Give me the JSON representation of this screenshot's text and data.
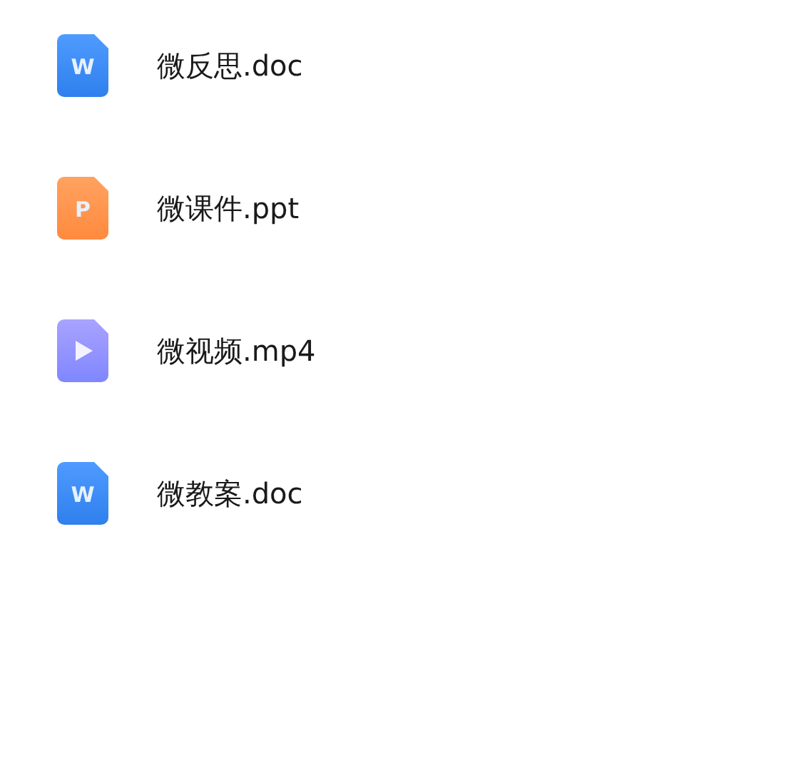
{
  "files": [
    {
      "name": "微反思.doc",
      "kind": "word",
      "letter": "W"
    },
    {
      "name": "微课件.ppt",
      "kind": "slides",
      "letter": "P"
    },
    {
      "name": "微视频.mp4",
      "kind": "video"
    },
    {
      "name": "微教案.doc",
      "kind": "word",
      "letter": "W"
    }
  ]
}
